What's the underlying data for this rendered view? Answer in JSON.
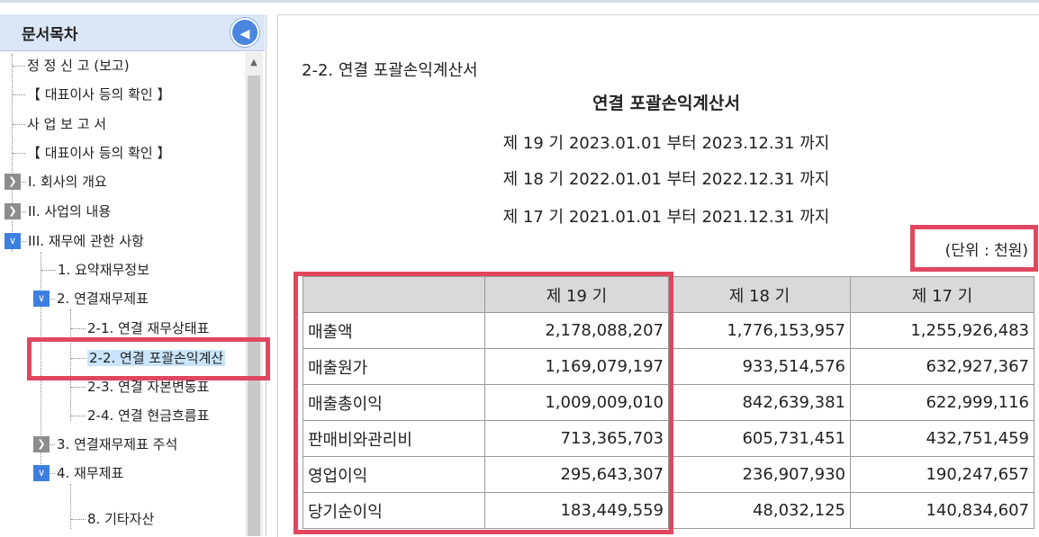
{
  "sidebar": {
    "title": "문서목차",
    "collapse_icon": "chevron-left-icon",
    "items": [
      {
        "label": "정 정 신 고 (보고)"
      },
      {
        "label": "【 대표이사 등의 확인 】"
      },
      {
        "label": "사 업 보 고 서"
      },
      {
        "label": "【 대표이사 등의 확인 】"
      },
      {
        "label": "I. 회사의 개요"
      },
      {
        "label": "II. 사업의 내용"
      },
      {
        "label": "III. 재무에 관한 사항"
      },
      {
        "label": "1. 요약재무정보"
      },
      {
        "label": "2. 연결재무제표"
      },
      {
        "label": "2-1. 연결 재무상태표"
      },
      {
        "label": "2-2. 연결 포괄손익계산"
      },
      {
        "label": "2-3. 연결 자본변동표"
      },
      {
        "label": "2-4. 연결 현금흐름표"
      },
      {
        "label": "3. 연결재무제표 주석"
      },
      {
        "label": "4. 재무제표"
      },
      {
        "label": "8. 기타자산"
      }
    ]
  },
  "content": {
    "section_title": "2-2. 연결 포괄손익계산서",
    "doc_title": "연결 포괄손익계산서",
    "periods": [
      "제 19 기 2023.01.01 부터 2023.12.31 까지",
      "제 18 기 2022.01.01 부터 2022.12.31 까지",
      "제 17 기 2021.01.01 부터 2021.12.31 까지"
    ],
    "unit": "(단위 : 천원)",
    "table": {
      "headers": [
        "",
        "제 19 기",
        "제 18 기",
        "제 17 기"
      ],
      "rows": [
        {
          "label": "매출액",
          "v19": "2,178,088,207",
          "v18": "1,776,153,957",
          "v17": "1,255,926,483"
        },
        {
          "label": "매출원가",
          "v19": "1,169,079,197",
          "v18": "933,514,576",
          "v17": "632,927,367"
        },
        {
          "label": "매출총이익",
          "v19": "1,009,009,010",
          "v18": "842,639,381",
          "v17": "622,999,116"
        },
        {
          "label": "판매비와관리비",
          "v19": "713,365,703",
          "v18": "605,731,451",
          "v17": "432,751,459"
        },
        {
          "label": "영업이익",
          "v19": "295,643,307",
          "v18": "236,907,930",
          "v17": "190,247,657"
        },
        {
          "label": "당기순이익",
          "v19": "183,449,559",
          "v18": "48,032,125",
          "v17": "140,834,607"
        }
      ]
    }
  },
  "colors": {
    "highlight": "#e0475f",
    "selected": "#c9e4fb",
    "header_bg": "#dbe6f7"
  }
}
